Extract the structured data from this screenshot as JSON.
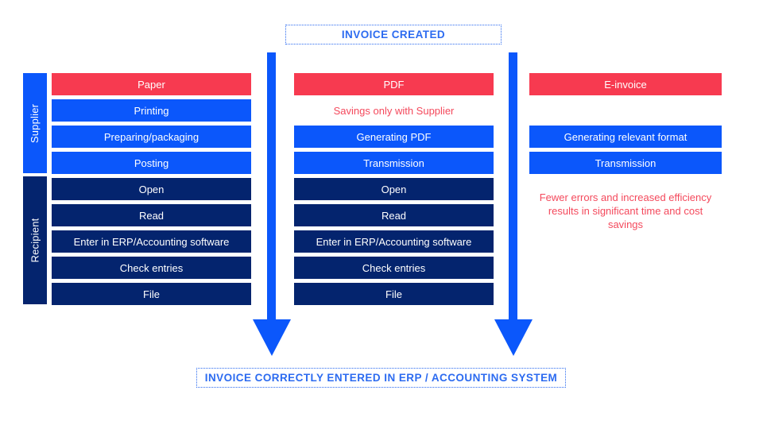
{
  "diagram": {
    "top_label": "INVOICE CREATED",
    "bottom_label": "INVOICE CORRECTLY ENTERED IN ERP / ACCOUNTING SYSTEM",
    "lanes": [
      {
        "name": "supplier",
        "label": "Supplier"
      },
      {
        "name": "recipient",
        "label": "Recipient"
      }
    ],
    "colors": {
      "red": "#F73A50",
      "blue": "#0B57FB",
      "navy": "#04246E",
      "note_red": "#F4495C",
      "label_blue": "#2C6BF0",
      "background": "#FFFFFF"
    },
    "columns": [
      {
        "name": "paper",
        "header": "Paper",
        "supplier_steps": [
          "Printing",
          "Preparing/packaging",
          "Posting"
        ],
        "recipient_steps": [
          "Open",
          "Read",
          "Enter in ERP/Accounting software",
          "Check entries",
          "File"
        ],
        "note": "",
        "benefit": ""
      },
      {
        "name": "pdf",
        "header": "PDF",
        "note": "Savings only with Supplier",
        "supplier_steps": [
          "Generating PDF",
          "Transmission"
        ],
        "recipient_steps": [
          "Open",
          "Read",
          "Enter in ERP/Accounting software",
          "Check entries",
          "File"
        ],
        "benefit": ""
      },
      {
        "name": "einvoice",
        "header": "E-invoice",
        "note": "",
        "supplier_steps": [
          "Generating relevant format",
          "Transmission"
        ],
        "recipient_steps": [],
        "benefit": "Fewer errors and increased efficiency results in significant time and cost savings"
      }
    ],
    "arrows": [
      {
        "name": "paper-flow-arrow"
      },
      {
        "name": "pdf-flow-arrow"
      }
    ]
  }
}
